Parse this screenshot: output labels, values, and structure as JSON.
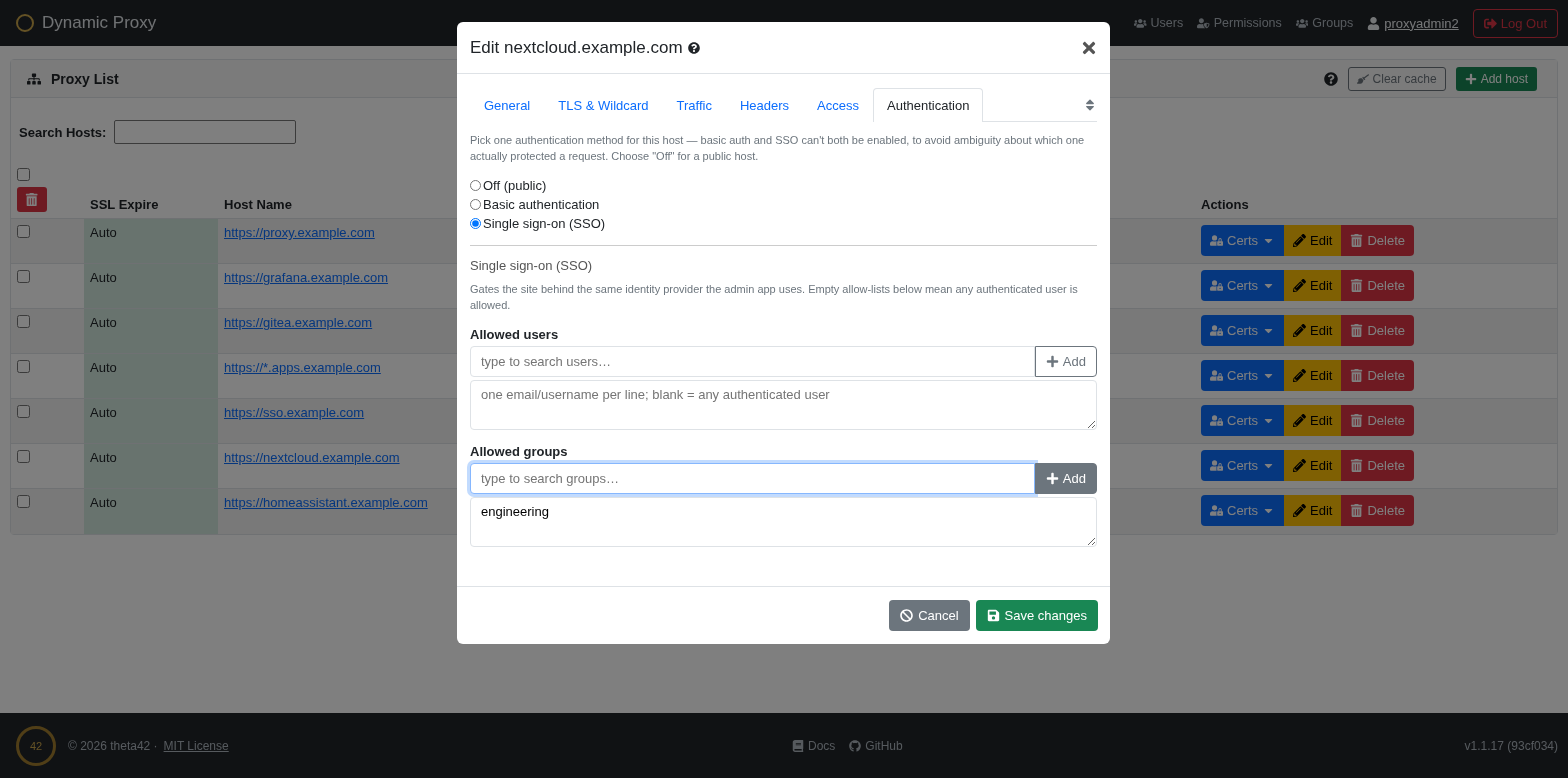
{
  "navbar": {
    "brand": "Dynamic Proxy",
    "items": [
      {
        "label": "Users",
        "kind": "users"
      },
      {
        "label": "Permissions",
        "kind": "permissions"
      },
      {
        "label": "Groups",
        "kind": "groups"
      }
    ],
    "user": "proxyadmin2",
    "logout": "Log Out"
  },
  "proxy_list": {
    "title": "Proxy List",
    "clear_cache": "Clear cache",
    "add_host": "Add host",
    "search_label": "Search Hosts:",
    "select_all_checked": false,
    "columns": [
      "SSL Expire",
      "Host Name",
      "Actions"
    ],
    "rows": [
      {
        "checked": false,
        "ssl_expire": "Auto",
        "host": "https://proxy.example.com",
        "actions": {
          "certs": "Certs",
          "edit": "Edit",
          "delete": "Delete"
        }
      },
      {
        "checked": false,
        "ssl_expire": "Auto",
        "host": "https://grafana.example.com",
        "actions": {
          "certs": "Certs",
          "edit": "Edit",
          "delete": "Delete"
        }
      },
      {
        "checked": false,
        "ssl_expire": "Auto",
        "host": "https://gitea.example.com",
        "actions": {
          "certs": "Certs",
          "edit": "Edit",
          "delete": "Delete"
        }
      },
      {
        "checked": false,
        "ssl_expire": "Auto",
        "host": "https://*.apps.example.com",
        "actions": {
          "certs": "Certs",
          "edit": "Edit",
          "delete": "Delete"
        }
      },
      {
        "checked": false,
        "ssl_expire": "Auto",
        "host": "https://sso.example.com",
        "actions": {
          "certs": "Certs",
          "edit": "Edit",
          "delete": "Delete"
        }
      },
      {
        "checked": false,
        "ssl_expire": "Auto",
        "host": "https://nextcloud.example.com",
        "actions": {
          "certs": "Certs",
          "edit": "Edit",
          "delete": "Delete"
        }
      },
      {
        "checked": false,
        "ssl_expire": "Auto",
        "host": "https://homeassistant.example.com",
        "actions": {
          "certs": "Certs",
          "edit": "Edit",
          "delete": "Delete"
        }
      }
    ]
  },
  "modal": {
    "title": "Edit nextcloud.example.com",
    "tabs": [
      {
        "label": "General",
        "selected": false
      },
      {
        "label": "TLS & Wildcard",
        "selected": false
      },
      {
        "label": "Traffic",
        "selected": false
      },
      {
        "label": "Headers",
        "selected": false
      },
      {
        "label": "Access",
        "selected": false
      },
      {
        "label": "Authentication",
        "selected": true
      }
    ],
    "intro": "Pick one authentication method for this host — basic auth and SSO can't both be enabled, to avoid ambiguity about which one actually protected a request. Choose \"Off\" for a public host.",
    "methods": [
      {
        "label": "Off (public)",
        "selected": false
      },
      {
        "label": "Basic authentication",
        "selected": false
      },
      {
        "label": "Single sign-on (SSO)",
        "selected": true
      }
    ],
    "section_title": "Single sign-on (SSO)",
    "section_text": "Gates the site behind the same identity provider the admin app uses. Empty allow-lists below mean any authenticated user is allowed.",
    "lists": [
      {
        "label": "Allowed users",
        "search_placeholder": "type to search users…",
        "focused": false,
        "add": "Add",
        "list_placeholder": "one email/username per line; blank = any authenticated user"
      },
      {
        "label": "Allowed groups",
        "search_placeholder": "type to search groups…",
        "focused": true,
        "add": "Add",
        "list_value": "engineering"
      }
    ],
    "cancel": "Cancel",
    "save": "Save changes"
  },
  "footer": {
    "logo_text": "42",
    "copyright": "© 2026 theta42 ·",
    "license": "MIT License",
    "docs": "Docs",
    "github": "GitHub",
    "version": "v1.1.17 (93cf034)"
  }
}
